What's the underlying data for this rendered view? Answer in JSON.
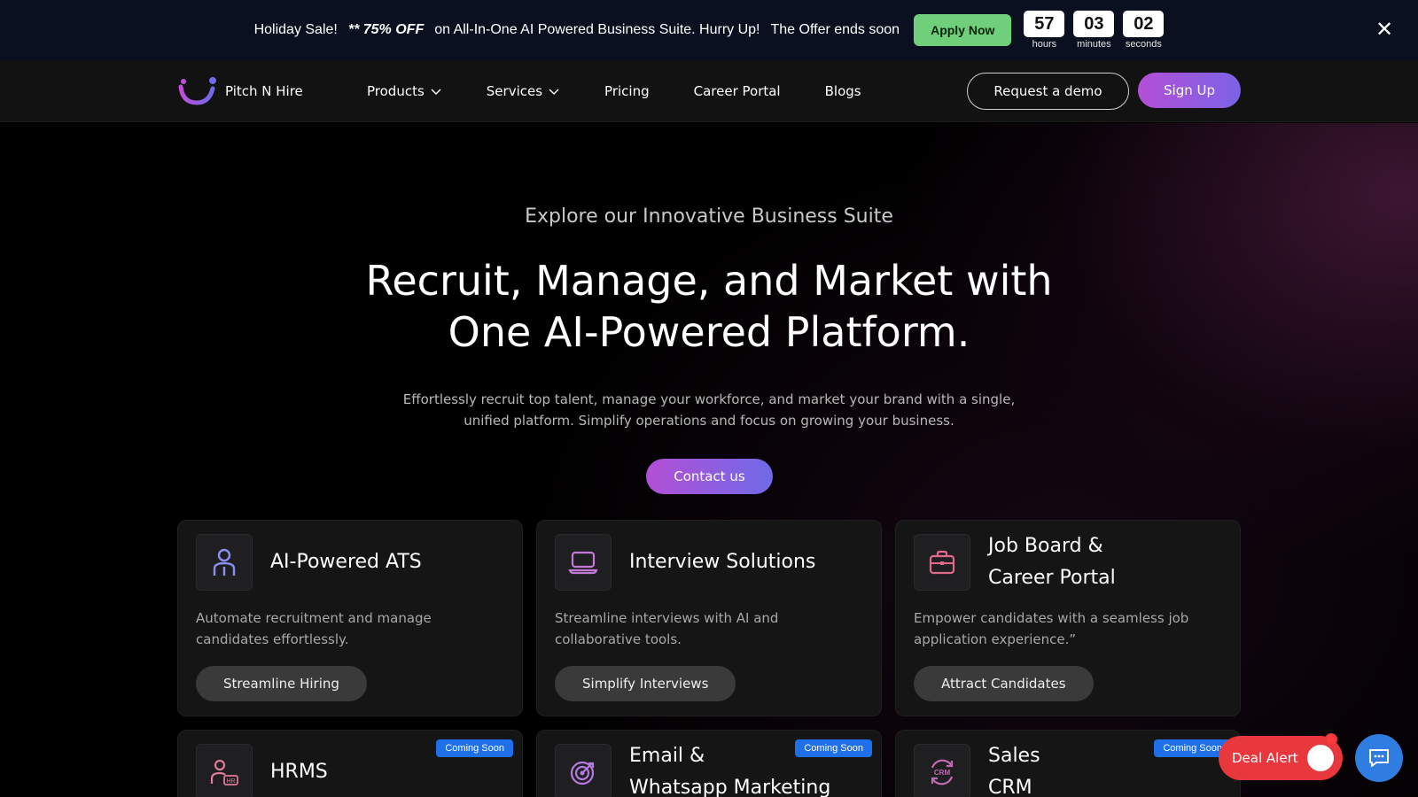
{
  "promo": {
    "sale_label": "Holiday Sale!",
    "discount_label": "** 75% OFF",
    "offer_text": "on All-In-One AI Powered Business Suite. Hurry Up!",
    "ends_text": "The Offer ends soon",
    "apply_label": "Apply Now",
    "countdown": [
      {
        "value": "57",
        "label": "hours"
      },
      {
        "value": "03",
        "label": "minutes"
      },
      {
        "value": "02",
        "label": "seconds"
      }
    ],
    "close_symbol": "✕"
  },
  "nav": {
    "brand": "Pitch N Hire",
    "links": [
      {
        "label": "Products",
        "dropdown": true
      },
      {
        "label": "Services",
        "dropdown": true
      },
      {
        "label": "Pricing",
        "dropdown": false
      },
      {
        "label": "Career Portal",
        "dropdown": false
      },
      {
        "label": "Blogs",
        "dropdown": false
      }
    ],
    "demo_label": "Request a demo",
    "signup_label": "Sign Up"
  },
  "hero": {
    "subhead": "Explore our Innovative Business Suite",
    "headline_line1": "Recruit, Manage, and Market with",
    "headline_line2": "One AI-Powered Platform.",
    "description_line1": "Effortlessly recruit top talent, manage your workforce, and market your brand with a single,",
    "description_line2": "unified platform. Simplify operations and focus on growing your business.",
    "contact_label": "Contact us"
  },
  "cards": [
    {
      "icon": "user-icon",
      "title": "AI-Powered ATS",
      "description": "Automate recruitment and manage candidates effortlessly.",
      "cta": "Streamline Hiring"
    },
    {
      "icon": "laptop-icon",
      "title": "Interview Solutions",
      "description": "Streamline interviews with AI and collaborative tools.",
      "cta": "Simplify Interviews"
    },
    {
      "icon": "briefcase-icon",
      "title_line1": "Job Board &",
      "title_line2": "Career Portal",
      "description": "Empower candidates with a seamless job application experience.”",
      "cta": "Attract Candidates"
    },
    {
      "icon": "hr-user-icon",
      "title": "HRMS",
      "badge": "Coming Soon"
    },
    {
      "icon": "target-icon",
      "title_line1": "Email &",
      "title_line2": "Whatsapp Marketing",
      "badge": "Coming Soon"
    },
    {
      "icon": "crm-icon",
      "title_line1": "Sales",
      "title_line2": "CRM",
      "badge": "Coming Soon"
    }
  ],
  "widgets": {
    "deal_alert_label": "Deal Alert"
  },
  "colors": {
    "accent_gradient_start": "#b34fd6",
    "accent_gradient_end": "#7b63e6",
    "apply_green": "#6fcf7a",
    "badge_blue": "#1f6fe8",
    "deal_red": "#e8383d",
    "chat_blue": "#2f7de0"
  }
}
